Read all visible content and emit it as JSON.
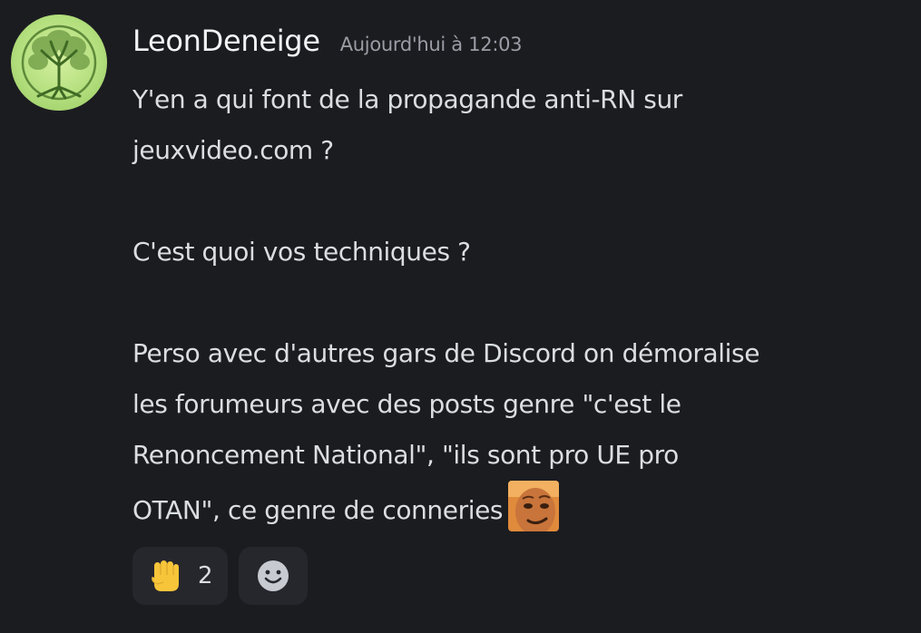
{
  "message": {
    "author": "LeonDeneige",
    "timestamp": "Aujourd'hui à 12:03",
    "avatar_icon": "tree-of-life-icon",
    "lines": [
      "Y'en a qui font de la propagande anti-RN sur",
      "jeuxvideo.com ?",
      "",
      "C'est quoi vos techniques ?",
      "",
      "Perso avec d'autres gars de Discord on démoralise",
      "les forumeurs avec des posts genre \"c'est le",
      "Renoncement National\", \"ils sont pro UE pro",
      "OTAN\", ce genre de conneries"
    ],
    "inline_emoji": "smirking-face-custom-emoji"
  },
  "reactions": [
    {
      "emoji": "raised-fist-icon",
      "count": "2"
    },
    {
      "emoji": "add-reaction-smiley-icon"
    }
  ],
  "colors": {
    "background": "#1b1c20",
    "username": "#f2f3f5",
    "text": "#dbdee1",
    "timestamp": "#9a9da5",
    "reaction_bg": "#26272d",
    "avatar_green": "#b4df7e"
  }
}
